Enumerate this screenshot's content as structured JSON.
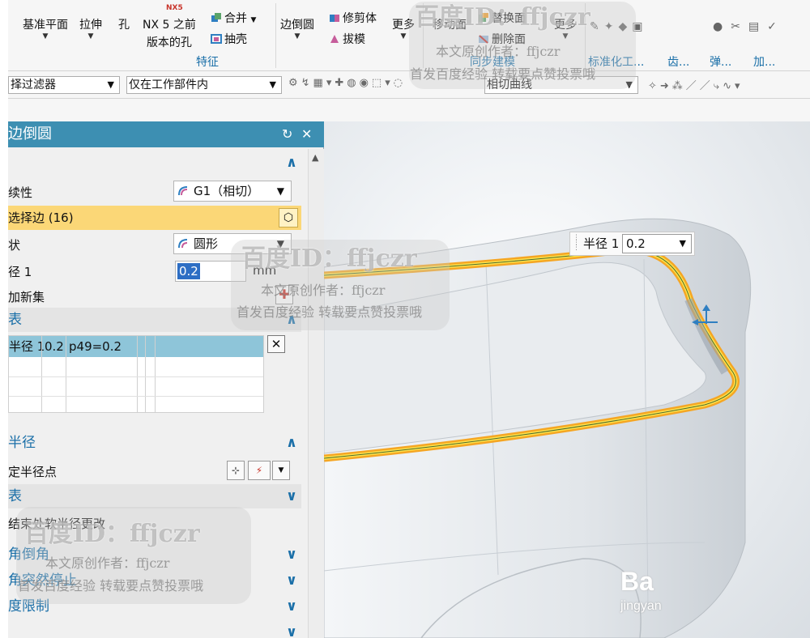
{
  "ribbon": {
    "datum_plane": "基准平面",
    "extrude": "拉伸",
    "hole": "孔",
    "nx5_badge": "NX5",
    "nx5_hole_line1": "NX 5 之前",
    "nx5_hole_line2": "版本的孔",
    "unite": "合并",
    "shell": "抽壳",
    "features_label": "特征",
    "edge_blend": "边倒圆",
    "trim_body": "修剪体",
    "draft": "拔模",
    "more1": "更多",
    "move_face": "移动面",
    "replace_face": "替换面",
    "delete_face": "删除面",
    "more2": "更多",
    "sync_modeling_label": "同步建模",
    "standard_label": "标准化工...",
    "gear_label": "齿...",
    "spring_label": "弹...",
    "add_label": "加..."
  },
  "toolbar": {
    "filter_value": "择过滤器",
    "scope_value": "仅在工作部件内",
    "curve_rule": "相切曲线"
  },
  "dialog": {
    "title": "边倒圆",
    "continuity_label": "续性",
    "continuity_value": "G1（相切）",
    "select_edge": "选择边 (16)",
    "shape_label": "状",
    "shape_value": "圆形",
    "radius_label": "径 1",
    "radius_value": "0.2",
    "unit": "mm",
    "add_new_set": "加新集",
    "list_label": "表",
    "list_row": {
      "name": "半径 1",
      "value": "0.2",
      "expr": "p49=0.2"
    },
    "variable_radius": "半径",
    "specify_radius_point": "定半径点",
    "list2_label": "表",
    "corner_note": "结束处软半径更改",
    "corner_setback": "角倒角",
    "corner_stop": "角突然停止",
    "length_limit": "度限制"
  },
  "viewport": {
    "callout_label": "半径 1",
    "callout_value": "0.2"
  },
  "watermark": {
    "id_text": "百度ID：ffjczr",
    "author": "本文原创作者：ffjczr",
    "notice": "首发百度经验 转载要点赞投票哦",
    "brand": "Ba",
    "brand_sub": "jingyan"
  },
  "colors": {
    "title_bar": "#3d8fb2",
    "selected_row": "#fbd777",
    "list_selected": "#8ec5d9",
    "accent_text": "#1a6fa8",
    "highlight_edge": "#f5a623"
  }
}
